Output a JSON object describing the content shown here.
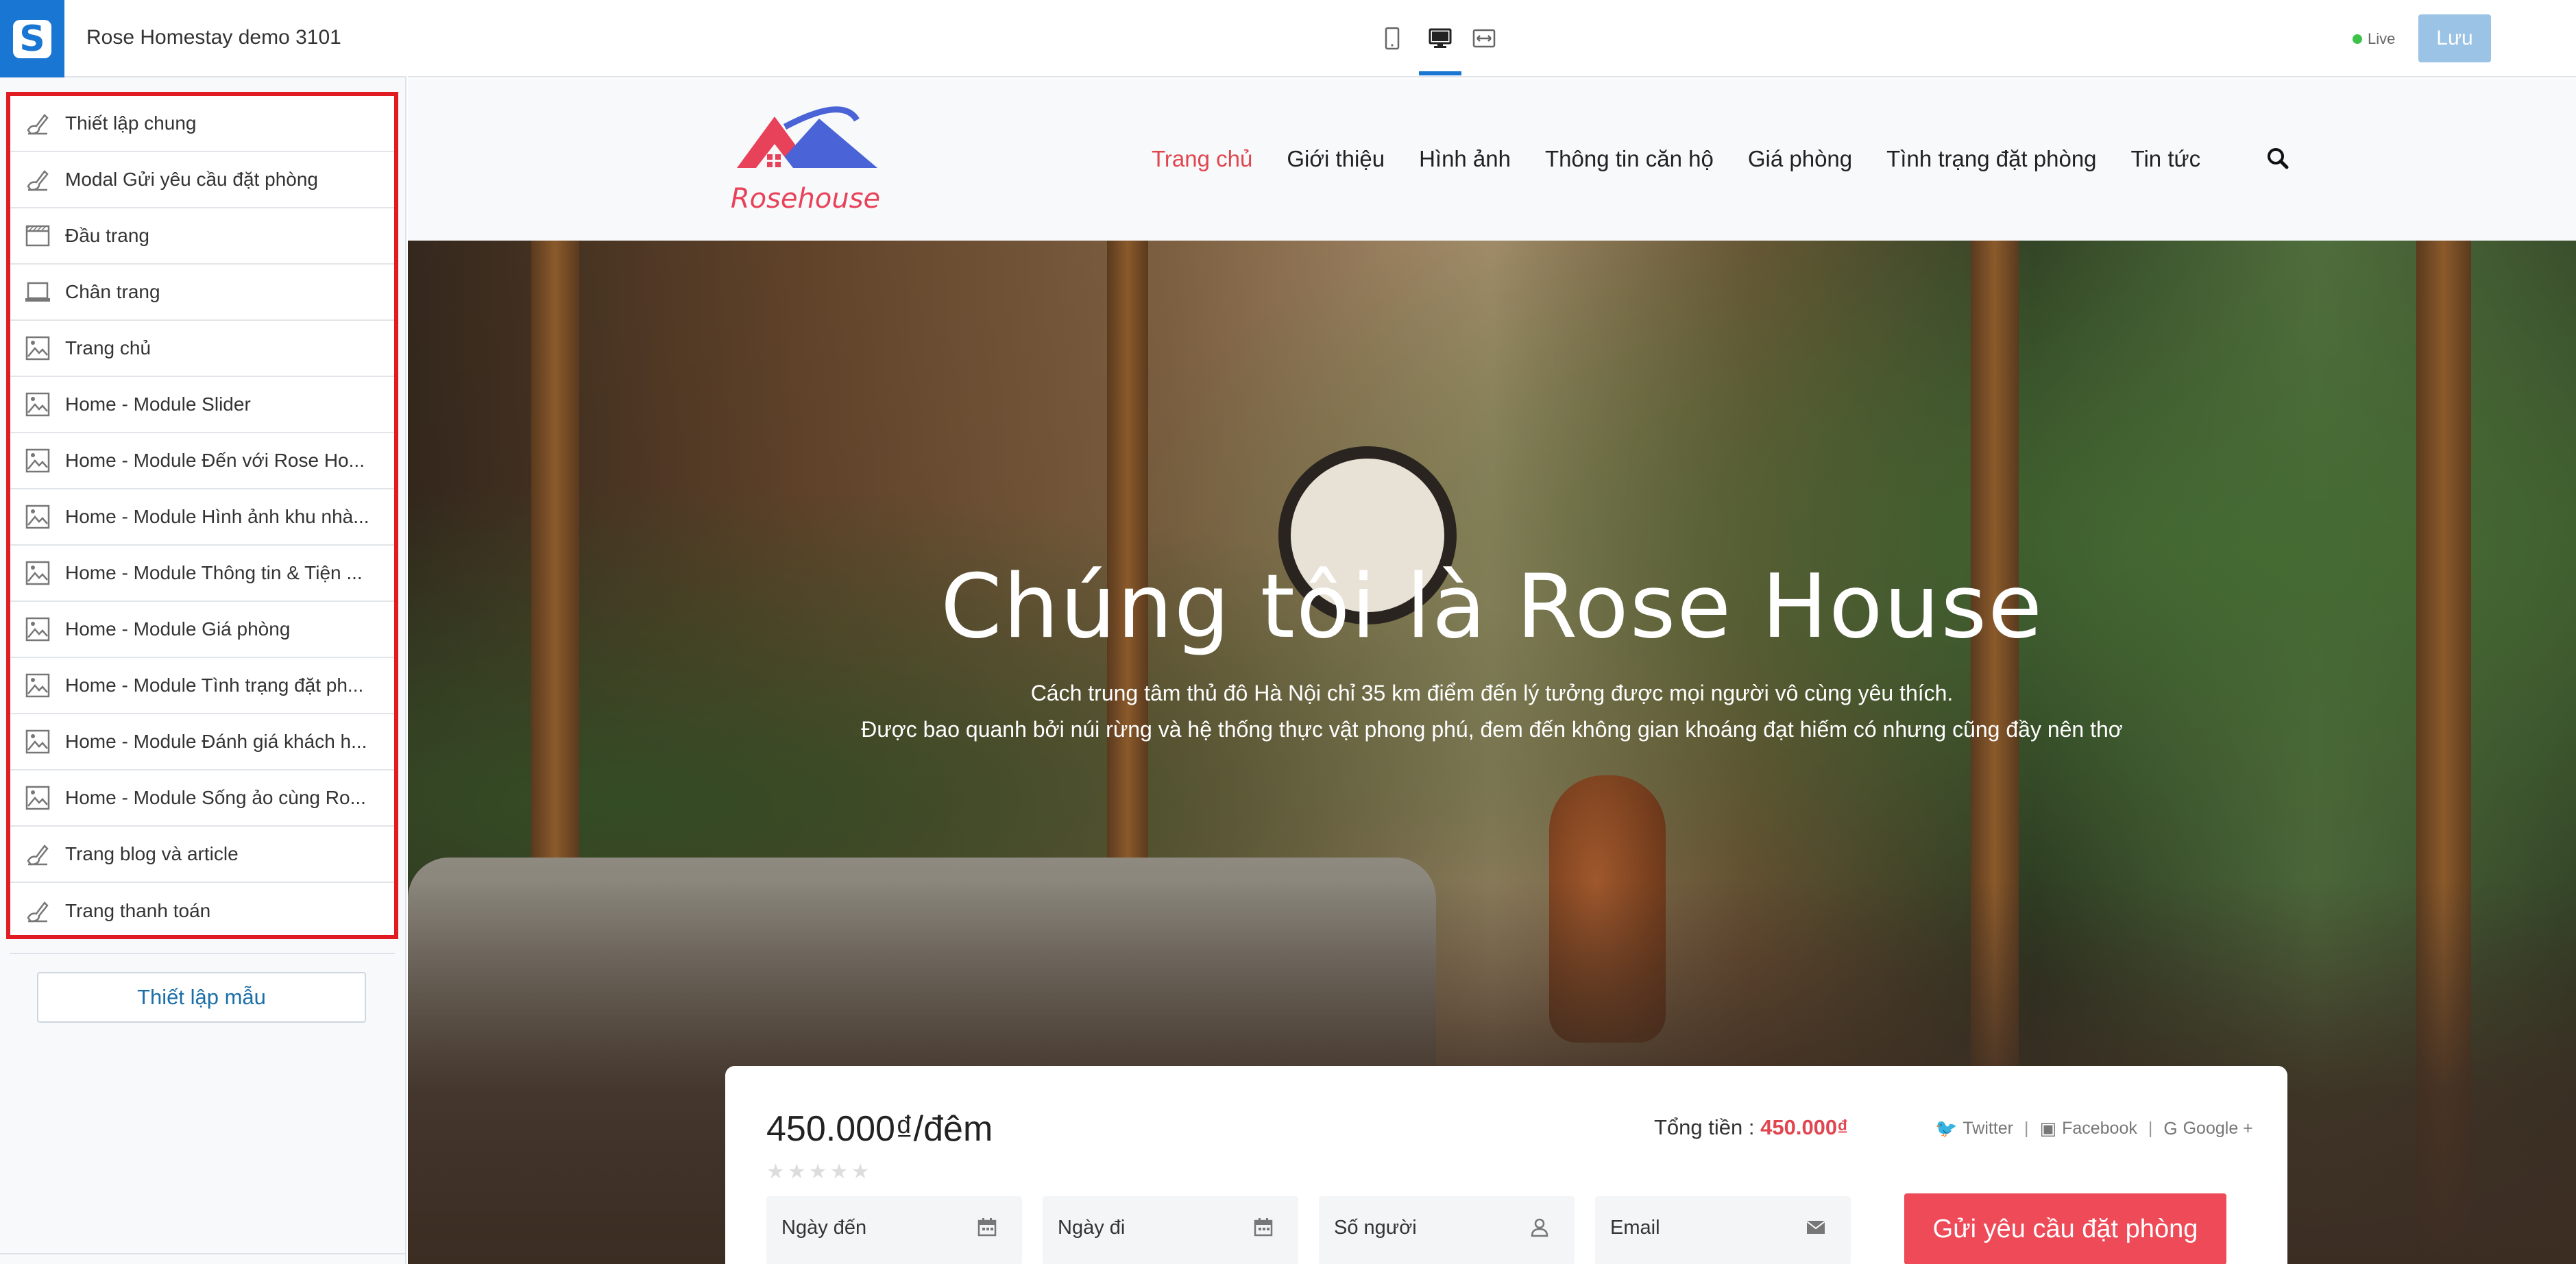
{
  "app": {
    "site_name": "Rose Homestay demo 3101",
    "live_label": "Live",
    "save_label": "Lưu",
    "template_button": "Thiết lập mẫu"
  },
  "sidebar": {
    "items": [
      {
        "label": "Thiết lập chung",
        "icon": "brush-icon"
      },
      {
        "label": "Modal Gửi yêu cầu đặt phòng",
        "icon": "brush-icon"
      },
      {
        "label": "Đầu trang",
        "icon": "header-layout-icon"
      },
      {
        "label": "Chân trang",
        "icon": "footer-layout-icon"
      },
      {
        "label": "Trang chủ",
        "icon": "image-page-icon"
      },
      {
        "label": "Home - Module Slider",
        "icon": "image-page-icon"
      },
      {
        "label": "Home - Module Đến với Rose Ho...",
        "icon": "image-page-icon"
      },
      {
        "label": "Home - Module Hình ảnh khu nhà...",
        "icon": "image-page-icon"
      },
      {
        "label": "Home - Module Thông tin & Tiện ...",
        "icon": "image-page-icon"
      },
      {
        "label": "Home - Module Giá phòng",
        "icon": "image-page-icon"
      },
      {
        "label": "Home - Module Tình trạng đặt ph...",
        "icon": "image-page-icon"
      },
      {
        "label": "Home - Module Đánh giá khách h...",
        "icon": "image-page-icon"
      },
      {
        "label": "Home - Module Sống ảo cùng Ro...",
        "icon": "image-page-icon"
      },
      {
        "label": "Trang blog và article",
        "icon": "brush-icon"
      },
      {
        "label": "Trang thanh toán",
        "icon": "brush-icon"
      }
    ]
  },
  "toolbar": {
    "devices": [
      {
        "name": "mobile-view-icon",
        "active": false
      },
      {
        "name": "desktop-view-icon",
        "active": true
      },
      {
        "name": "fullwidth-view-icon",
        "active": false
      }
    ],
    "accent": "#1976d2"
  },
  "site": {
    "brand": "Rosehouse",
    "nav": [
      "Trang chủ",
      "Giới thiệu",
      "Hình ảnh",
      "Thông tin căn hộ",
      "Giá phòng",
      "Tình trạng đặt phòng",
      "Tin tức"
    ],
    "active_nav": "Trang chủ",
    "hero": {
      "title": "Chúng tôi là Rose House",
      "line1": "Cách trung tâm thủ đô Hà Nội chỉ 35 km điểm đến lý tưởng được mọi người vô cùng yêu thích.",
      "line2": "Được bao quanh bởi núi rừng và hệ thống thực vật phong phú, đem đến không gian khoáng đạt hiếm có nhưng cũng đầy nên thơ"
    },
    "booking": {
      "price": "450.000₫/đêm",
      "stars": "★★★★★",
      "total_label": "Tổng tiền :",
      "total_value": "450.000₫",
      "share": [
        "Twitter",
        "Facebook",
        "Google +"
      ],
      "fields": [
        {
          "label": "Ngày đến",
          "icon": "calendar-icon"
        },
        {
          "label": "Ngày đi",
          "icon": "calendar-icon"
        },
        {
          "label": "Số người",
          "icon": "user-icon"
        },
        {
          "label": "Email",
          "icon": "envelope-icon"
        }
      ],
      "submit": "Gửi yêu cầu đặt phòng"
    },
    "colors": {
      "accent": "#e0464f",
      "button": "#ee4a58"
    }
  }
}
